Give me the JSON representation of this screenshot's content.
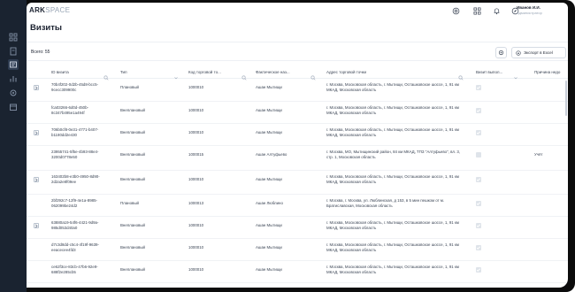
{
  "app": {
    "logo_bold": "ARK",
    "logo_light": "SPACE"
  },
  "user": {
    "name": "Иванов И.И.",
    "role": "Администратор"
  },
  "page": {
    "title": "Визиты"
  },
  "toolbar": {
    "total_label": "Всего: 55",
    "export_label": "Экспорт в Excel"
  },
  "columns": [
    "ID визита",
    "Тип",
    "Код торговой то...",
    "Фактическое наз...",
    "Адрес торговой точки",
    "Визит выпол...",
    "Причина недо"
  ],
  "rows": [
    {
      "id": "70b4f202-0d2b-45d8-bcc5-9cecc309900c",
      "type": "Плановый",
      "code": "1000010",
      "name": "Ашан Мытищи",
      "address": "г. Москва, Московская область, г. Мытищи, Осташковское шоссе, 1, 91 км МКАД, Московская область",
      "done": true,
      "reason": ""
    },
    {
      "id": "fca03266-6d0d-450b-8c347b495e1a494f",
      "type": "Внеплановый",
      "code": "1000010",
      "name": "Ашан Мытищи",
      "address": "г. Москва, Московская область, г. Мытищи, Осташковское шоссе, 1, 91 км МКАД, Московская область",
      "done": true,
      "reason": ""
    },
    {
      "id": "706b0cf8-0e31-4771-b407-b1180dd2e430",
      "type": "Внеплановый",
      "code": "1000010",
      "name": "Ашан Мытищи",
      "address": "г. Москва, Московская область, г. Мытищи, Осташковское шоссе, 1, 91 км МКАД, Московская область",
      "done": true,
      "reason": ""
    },
    {
      "id": "23955741-5f5e-4b93-88e4-3200d0778e50",
      "type": "Внеплановый",
      "code": "1000015",
      "name": "Ашан Алтуфьево",
      "address": "г. Москва, МО, Мытищинский район, 84 км МКАД, ТПЗ \"Алтуфьево\", вл. 3, стр. 1, Московская область",
      "done": false,
      "reason": "Учёт"
    },
    {
      "id": "163402b8-e3b0-4950-8d90-2d2a2e8f09ee",
      "type": "Внеплановый",
      "code": "1000010",
      "name": "Ашан Мытищи",
      "address": "г. Москва, Московская область, г. Мытищи, Осташковское шоссе, 1, 91 км МКАД, Московская область",
      "done": true,
      "reason": ""
    },
    {
      "id": "2bf292c7-12f9-4e1a-8985-062099be24d2",
      "type": "Плановый",
      "code": "1000013",
      "name": "Ашан Люблино",
      "address": "г. Москва, г. Москва, ул. Люблинская, д 153, в 5 мин пешком от м. Братиславская, Московская область",
      "done": true,
      "reason": ""
    },
    {
      "id": "63880a19-54f6-4421-9d9a-985d053d40a0",
      "type": "Внеплановый",
      "code": "1000010",
      "name": "Ашан Мытищи",
      "address": "г. Москва, Московская область, г. Мытищи, Осташковское шоссе, 1, 91 км МКАД, Московская область",
      "done": true,
      "reason": ""
    },
    {
      "id": "d7c3d8dd-c5c4-4f19f-9639-eeacecee4fd3",
      "type": "Внеплановый",
      "code": "1000010",
      "name": "Ашан Мытищи",
      "address": "г. Москва, Московская область, г. Мытищи, Осташковское шоссе, 1, 91 км МКАД, Московская область",
      "done": true,
      "reason": ""
    },
    {
      "id": "ce62f3ce-83cb-47b6-92e9-688f2e285cb5",
      "type": "Внеплановый",
      "code": "1000010",
      "name": "Ашан Мытищи",
      "address": "г. Москва, Московская область, г. Мытищи, Осташковское шоссе, 1, 91 км МКАД, Московская область",
      "done": true,
      "reason": ""
    }
  ],
  "icons": {
    "rail": [
      "grid-icon",
      "file-icon",
      "tasks-icon",
      "chart-icon",
      "settings-icon",
      "calendar-icon"
    ],
    "top": [
      "support-icon",
      "apps-icon",
      "bell-icon",
      "compass-icon"
    ]
  },
  "colors": {
    "rail": "#1a2330",
    "accent": "#1b2230",
    "muted": "#9aa6b6"
  }
}
